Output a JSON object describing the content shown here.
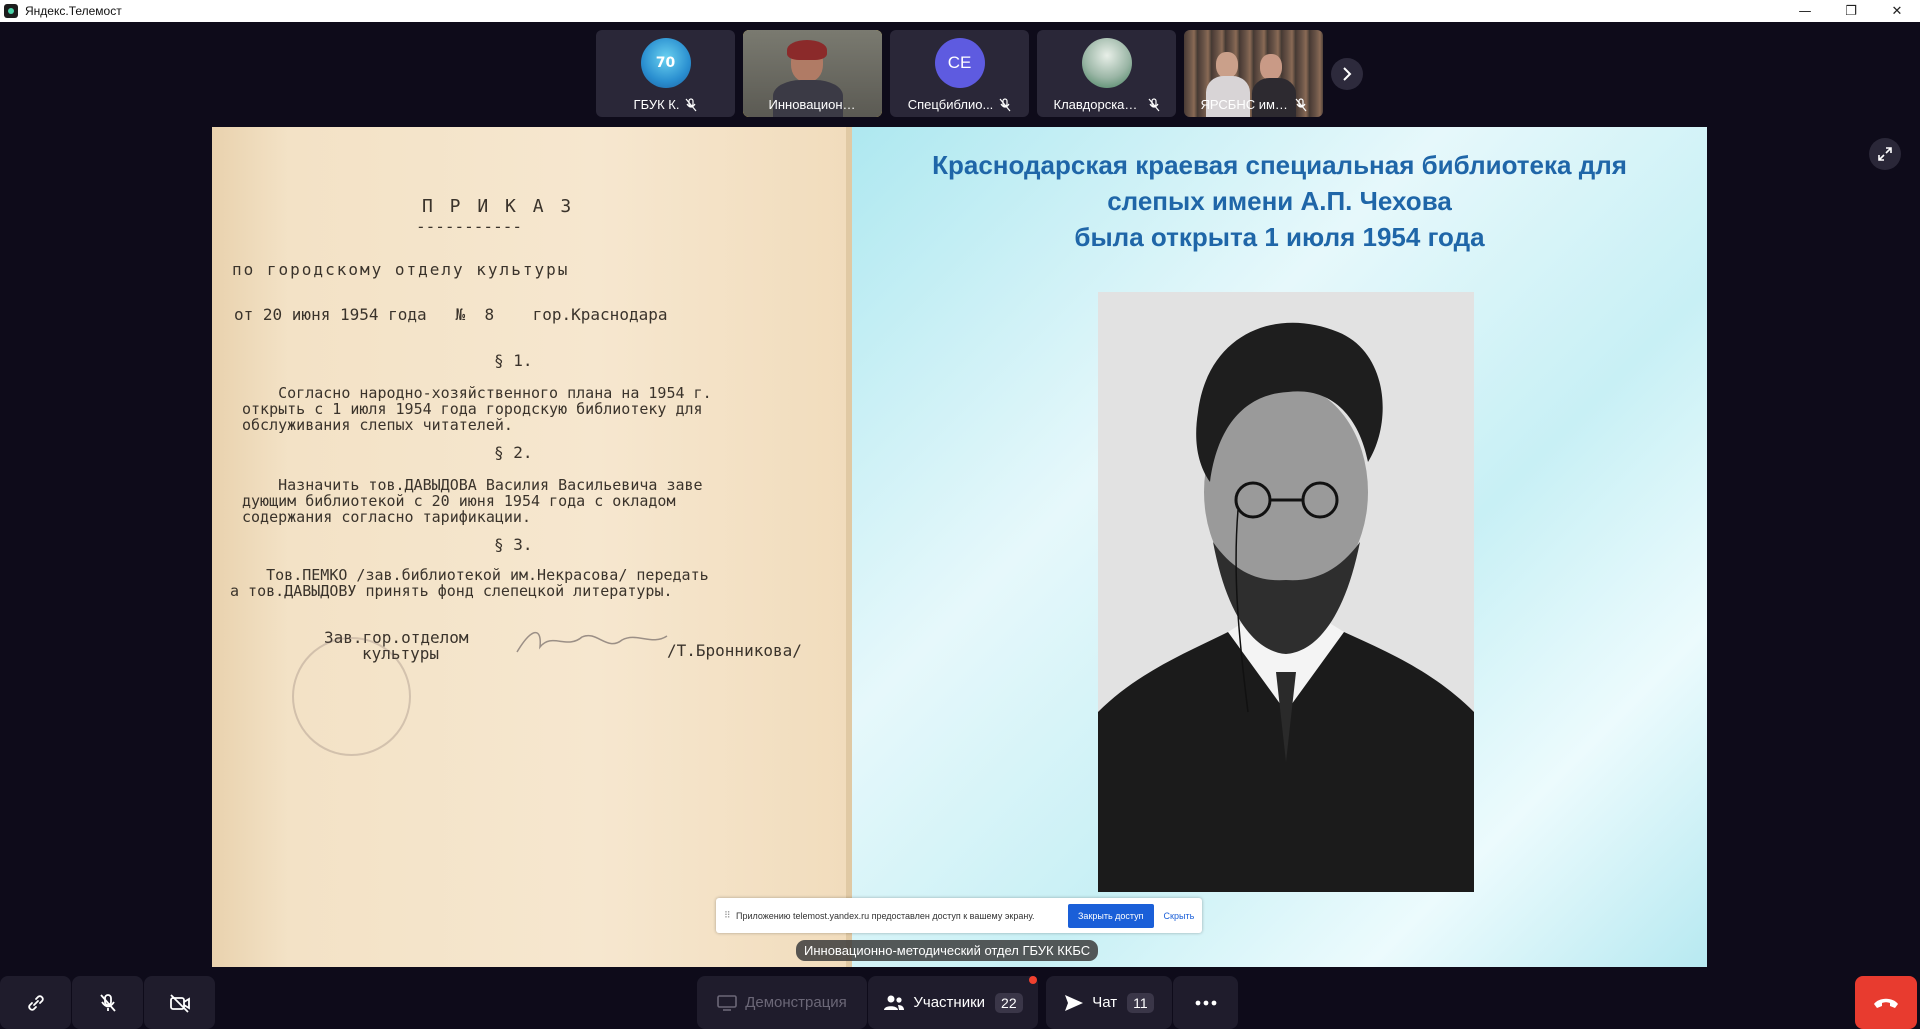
{
  "window": {
    "title": "Яндекс.Телемост",
    "minimize": "—",
    "restore": "❐",
    "close": "✕"
  },
  "participants": [
    {
      "name": "ГБУК К.",
      "muted": true
    },
    {
      "name": "Инновационно-...",
      "muted": false,
      "active": true
    },
    {
      "name": "Спецбиблио...",
      "initials": "СЕ",
      "muted": true
    },
    {
      "name": "Клавдорская...",
      "muted": true
    },
    {
      "name": "ЯРСБНС им. ...",
      "muted": true
    }
  ],
  "slide": {
    "title_line1": "Краснодарская краевая специальная библиотека для",
    "title_line2": "слепых имени А.П. Чехова",
    "title_line3": "была открыта 1 июля 1954 года",
    "document": {
      "heading": "П Р И К А З",
      "underline": "-----------",
      "line1": "по городскому отделу культуры",
      "line2": "от 20 июня 1954 года   №  8    гор.Краснодара",
      "sec1": "§ 1.",
      "p1a": "    Согласно народно-хозяйственного плана на 1954 г.",
      "p1b": "открыть с 1 июля 1954 года городскую библиотеку для",
      "p1c": "обслуживания слепых читателей.",
      "sec2": "§ 2.",
      "p2a": "    Назначить тов.ДАВЫДОВА Василия Васильевича заве",
      "p2b": "дующим библиотекой с 20 июня 1954 года с окладом",
      "p2c": "содержания согласно тарификации.",
      "sec3": "§ 3.",
      "p3a": "    Тов.ПЕМКО /зав.библиотекой им.Некрасова/ передать",
      "p3b": "а тов.ДАВЫДОВУ принять фонд слепецкой литературы.",
      "sig1": "Зав.гор.отделом",
      "sig2": "культуры",
      "sig3": "/Т.Бронникова/"
    }
  },
  "toast": {
    "message": "Приложению telemost.yandex.ru предоставлен доступ к вашему экрану.",
    "stop_button": "Закрыть доступ",
    "hide_link": "Скрыть"
  },
  "caption": "Инновационно-методический отдел ГБУК ККБС",
  "toolbar": {
    "demo_label": "Демонстрация",
    "participants_label": "Участники",
    "participants_count": "22",
    "chat_label": "Чат",
    "chat_count": "11"
  },
  "colors": {
    "background": "#0e0b1a",
    "accent_active": "#f5c518",
    "title_blue": "#1f66a8",
    "hangup_red": "#e83b2f"
  }
}
